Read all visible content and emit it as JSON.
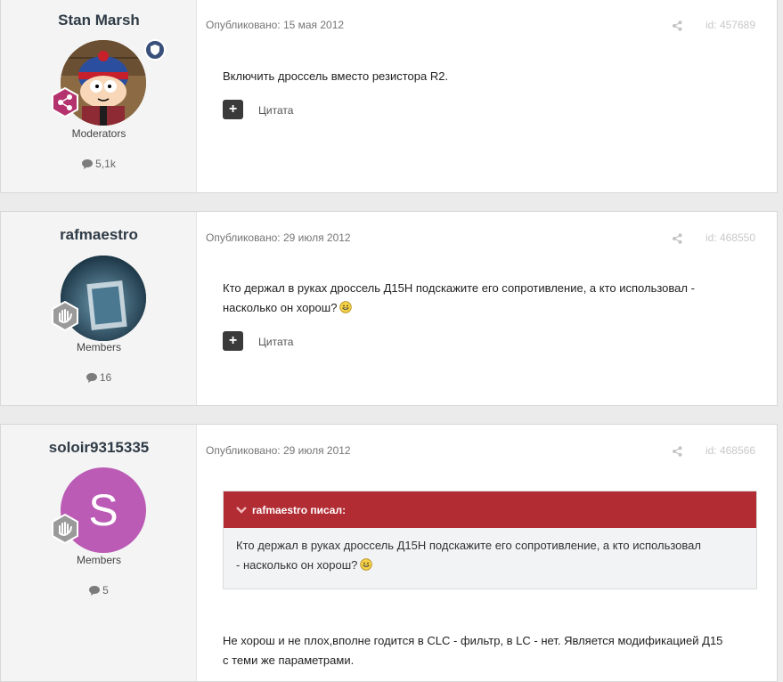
{
  "posts": [
    {
      "author": "Stan Marsh",
      "group": "Moderators",
      "post_count": "5,1k",
      "date_label": "Опубликовано: 15 мая 2012",
      "post_id": "id: 457689",
      "body": "Включить дроссель вместо резистора R2.",
      "quote_label": "Цитата"
    },
    {
      "author": "rafmaestro",
      "group": "Members",
      "post_count": "16",
      "date_label": "Опубликовано: 29 июля 2012",
      "post_id": "id: 468550",
      "body_line1": "Кто держал в руках дроссель Д15Н подскажите его сопротивление, а кто использовал -",
      "body_line2": "насколько он хорош?",
      "quote_label": "Цитата"
    },
    {
      "author": "soloir9315335",
      "avatar_letter": "S",
      "group": "Members",
      "post_count": "5",
      "date_label": "Опубликовано: 29 июля 2012",
      "post_id": "id: 468566",
      "quote_header": "rafmaestro писал:",
      "quote_line1": "Кто держал в руках дроссель Д15Н подскажите его сопротивление, а кто использовал",
      "quote_line2": "- насколько он хорош?",
      "body_line1": "Не хорош и не плох,вполне годится в CLC - фильтр, в LC - нет. Является модификацией Д15",
      "body_line2": "с теми же параметрами."
    }
  ],
  "colors": {
    "quote_header_bg": "#b12c33",
    "avatar_s_bg": "#bb5bb5",
    "mod_badge": "#b4336e"
  }
}
